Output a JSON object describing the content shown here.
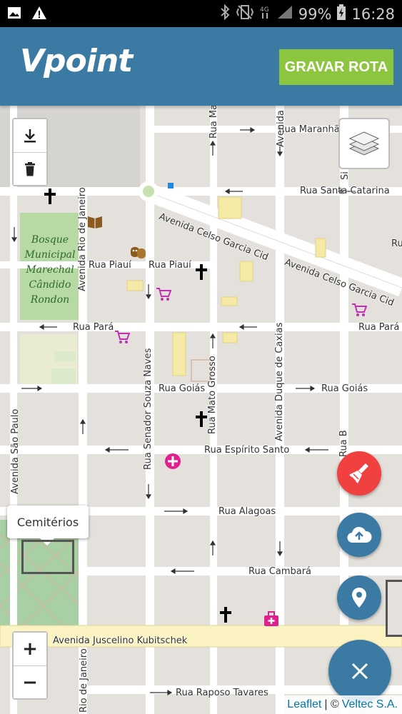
{
  "status_bar": {
    "battery": "99%",
    "time": "16:28",
    "icons": [
      "image-icon",
      "warning-icon",
      "bluetooth-icon",
      "vibrate-icon",
      "signal-4g-icon",
      "signal-icon",
      "battery-charging-icon"
    ]
  },
  "header": {
    "logo": "Vpoint",
    "record_button": "GRAVAR ROTA"
  },
  "map": {
    "streets": {
      "rua_maranhao": "Rua Maranhã",
      "rua_santa_catarina": "Rua Santa Catarina",
      "avenida_celso_garcia_cid_1": "Avenida Celso Garcia Cid",
      "avenida_celso_garcia_cid_2": "Avenida Celso Garcia Cid",
      "rua_piaui_1": "Rua Piauí",
      "rua_piaui_2": "Rua Piauí",
      "rua_para_1": "Rua Pará",
      "rua_para_2": "Rua Pará",
      "rua_goias_1": "Rua Goiás",
      "rua_goias_2": "Rua Goiás",
      "rua_espirito_santo": "Rua Espírito Santo",
      "rua_alagoas": "Rua Alagoas",
      "rua_cambara": "Rua Cambará",
      "avenida_juscelino": "Avenida Juscelino Kubitschek",
      "rua_raposo_tavares": "Rua Raposo Tavares",
      "avenida_rio_de_janeiro_1": "Avenida Rio de Janeiro",
      "avenida_rio_de_janeiro_2": "Rio de Janeiro",
      "rua_senador_souza_naves": "Rua Senador Souza Naves",
      "rua_mato_grosso": "Rua Mato Grosso",
      "rua_ma": "Rua Ma",
      "avenida_duque_de_caxias": "Avenida Duque de Caxias",
      "avenida_top": "Avenida",
      "avenida_sao_paulo": "Avenida São Paulo",
      "rua_r": "Ru",
      "rua_b": "Rua B",
      "rua_si": "Si"
    },
    "park_name": [
      "Bosque",
      "Municipal",
      "Marechal",
      "Cândido",
      "Rondon"
    ],
    "tooltip": "Cemitérios",
    "zoom_in": "+",
    "zoom_out": "−",
    "attribution": {
      "leaflet": "Leaflet",
      "separator": "| ©",
      "owner": "Veltec S.A."
    },
    "colors": {
      "fab_clear": "#f04040",
      "fab_blue": "#3a7aa3",
      "park": "#b7d9a3",
      "road": "#ffffff",
      "highway": "#fbf4c2"
    },
    "fabs": [
      "broom-icon",
      "cloud-upload-icon",
      "map-marker-icon",
      "close-icon"
    ]
  }
}
